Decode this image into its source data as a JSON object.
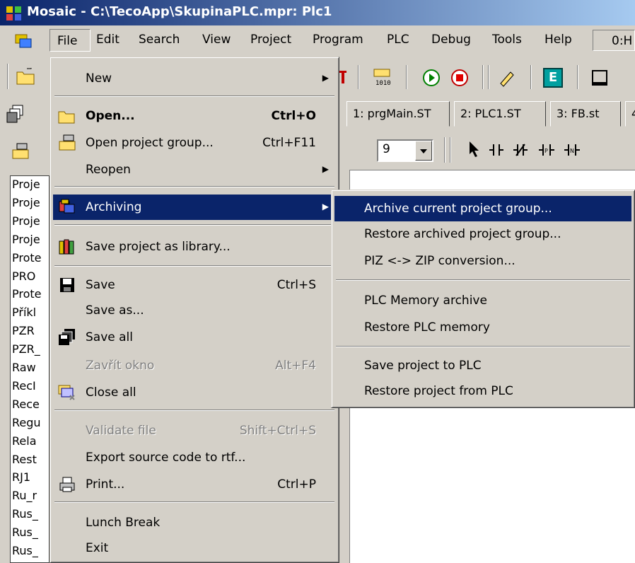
{
  "window": {
    "title": "Mosaic - C:\\TecoApp\\SkupinaPLC.mpr: Plc1"
  },
  "menubar": {
    "items": [
      "File",
      "Edit",
      "Search",
      "View",
      "Project",
      "Program",
      "PLC",
      "Debug",
      "Tools",
      "Help"
    ],
    "status": "0:H"
  },
  "tabs": [
    "1: prgMain.ST",
    "2: PLC1.ST",
    "3: FB.st",
    "4"
  ],
  "editor_toolbar": {
    "combo_value": "9",
    "e_button": "E"
  },
  "left_panel": {
    "items": [
      "Proje",
      "Proje",
      "Proje",
      "Proje",
      "Prote",
      "PRO",
      "Prote",
      "Příkl",
      "PZR",
      "PZR_",
      "Raw",
      "RecI",
      "Rece",
      "Regu",
      "Rela",
      "Rest",
      "RJ1",
      "Ru_r",
      "Rus_",
      "Rus_",
      "Rus_"
    ]
  },
  "file_menu": {
    "items": [
      {
        "label": "New",
        "submenu": true
      },
      {
        "label": "Open...",
        "shortcut": "Ctrl+O",
        "bold": true,
        "icon": "open-folder-icon"
      },
      {
        "label": "Open project group...",
        "shortcut": "Ctrl+F11",
        "icon": "open-project-group-icon"
      },
      {
        "label": "Reopen",
        "submenu": true
      },
      {
        "label": "Archiving",
        "submenu": true,
        "highlighted": true,
        "icon": "archive-icon"
      },
      {
        "label": "Save project as library...",
        "icon": "library-icon"
      },
      {
        "label": "Save",
        "shortcut": "Ctrl+S",
        "icon": "floppy-disk-icon"
      },
      {
        "label": "Save as..."
      },
      {
        "label": "Save all",
        "icon": "save-all-icon"
      },
      {
        "label": "Zavřít okno",
        "shortcut": "Alt+F4",
        "disabled": true
      },
      {
        "label": "Close all",
        "icon": "close-all-icon"
      },
      {
        "label": "Validate file",
        "shortcut": "Shift+Ctrl+S",
        "disabled": true
      },
      {
        "label": "Export source code to rtf..."
      },
      {
        "label": "Print...",
        "shortcut": "Ctrl+P",
        "icon": "printer-icon"
      },
      {
        "label": "Lunch Break"
      },
      {
        "label": "Exit"
      }
    ]
  },
  "archiving_submenu": {
    "items": [
      {
        "label": "Archive current project group...",
        "highlighted": true
      },
      {
        "label": "Restore archived project group..."
      },
      {
        "label": "PIZ <-> ZIP conversion..."
      },
      {
        "label": "PLC Memory archive"
      },
      {
        "label": "Restore PLC memory"
      },
      {
        "label": "Save project to PLC"
      },
      {
        "label": "Restore project from PLC"
      }
    ]
  },
  "colors": {
    "highlight": "#0a246a",
    "face": "#d4d0c8"
  }
}
